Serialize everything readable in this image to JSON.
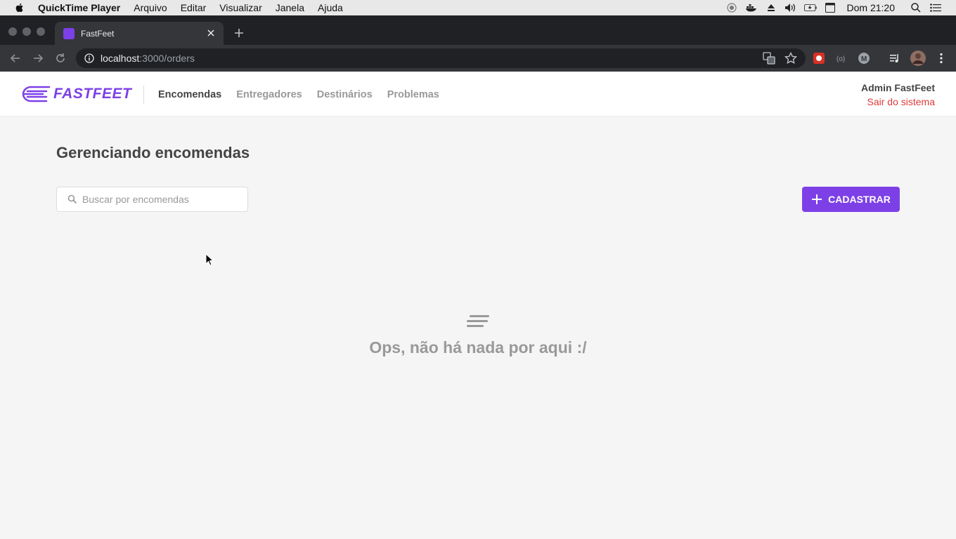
{
  "menubar": {
    "app_name": "QuickTime Player",
    "items": [
      "Arquivo",
      "Editar",
      "Visualizar",
      "Janela",
      "Ajuda"
    ],
    "clock": "Dom 21:20"
  },
  "browser": {
    "tab_title": "FastFeet",
    "url_host": "localhost",
    "url_path": ":3000/orders"
  },
  "app": {
    "logo_text": "FASTFEET",
    "nav": [
      {
        "label": "Encomendas",
        "active": true
      },
      {
        "label": "Entregadores",
        "active": false
      },
      {
        "label": "Destinários",
        "active": false
      },
      {
        "label": "Problemas",
        "active": false
      }
    ],
    "user_name": "Admin FastFeet",
    "logout_label": "Sair do sistema",
    "brand_color": "#7d40e7",
    "logout_color": "#de3b3b"
  },
  "page": {
    "title": "Gerenciando encomendas",
    "search_placeholder": "Buscar por encomendas",
    "add_button_label": "CADASTRAR",
    "empty_message": "Ops, não há nada por aqui :/"
  }
}
